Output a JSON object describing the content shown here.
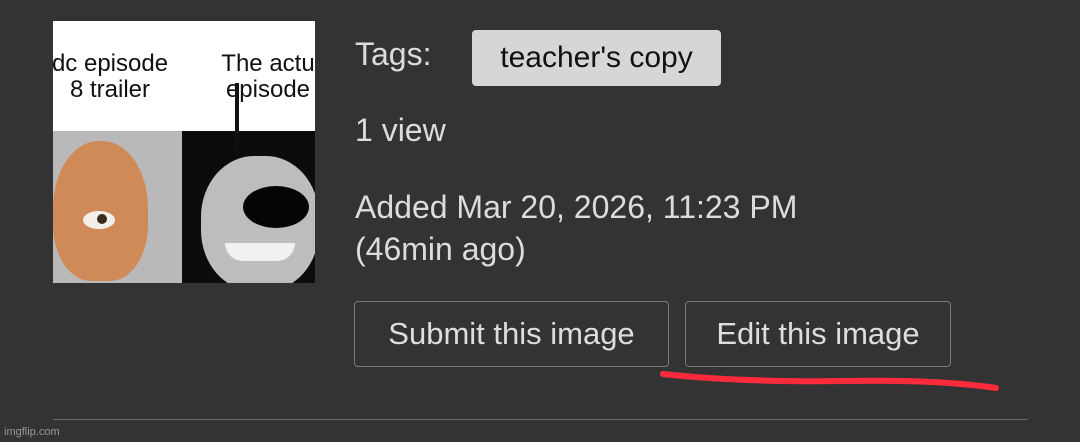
{
  "thumbnail": {
    "left_caption": "dc episode\n8 trailer",
    "right_caption": "The actu\nepisode"
  },
  "meta": {
    "tags_label": "Tags:",
    "tag": "teacher's copy",
    "views": "1 view",
    "added_line1": "Added Mar 20, 2026, 11:23 PM",
    "added_line2": "(46min ago)"
  },
  "actions": {
    "submit_label": "Submit this image",
    "edit_label": "Edit this image"
  },
  "annotation": {
    "underline_color": "#ff2b3d"
  },
  "watermark": "imgflip.com"
}
